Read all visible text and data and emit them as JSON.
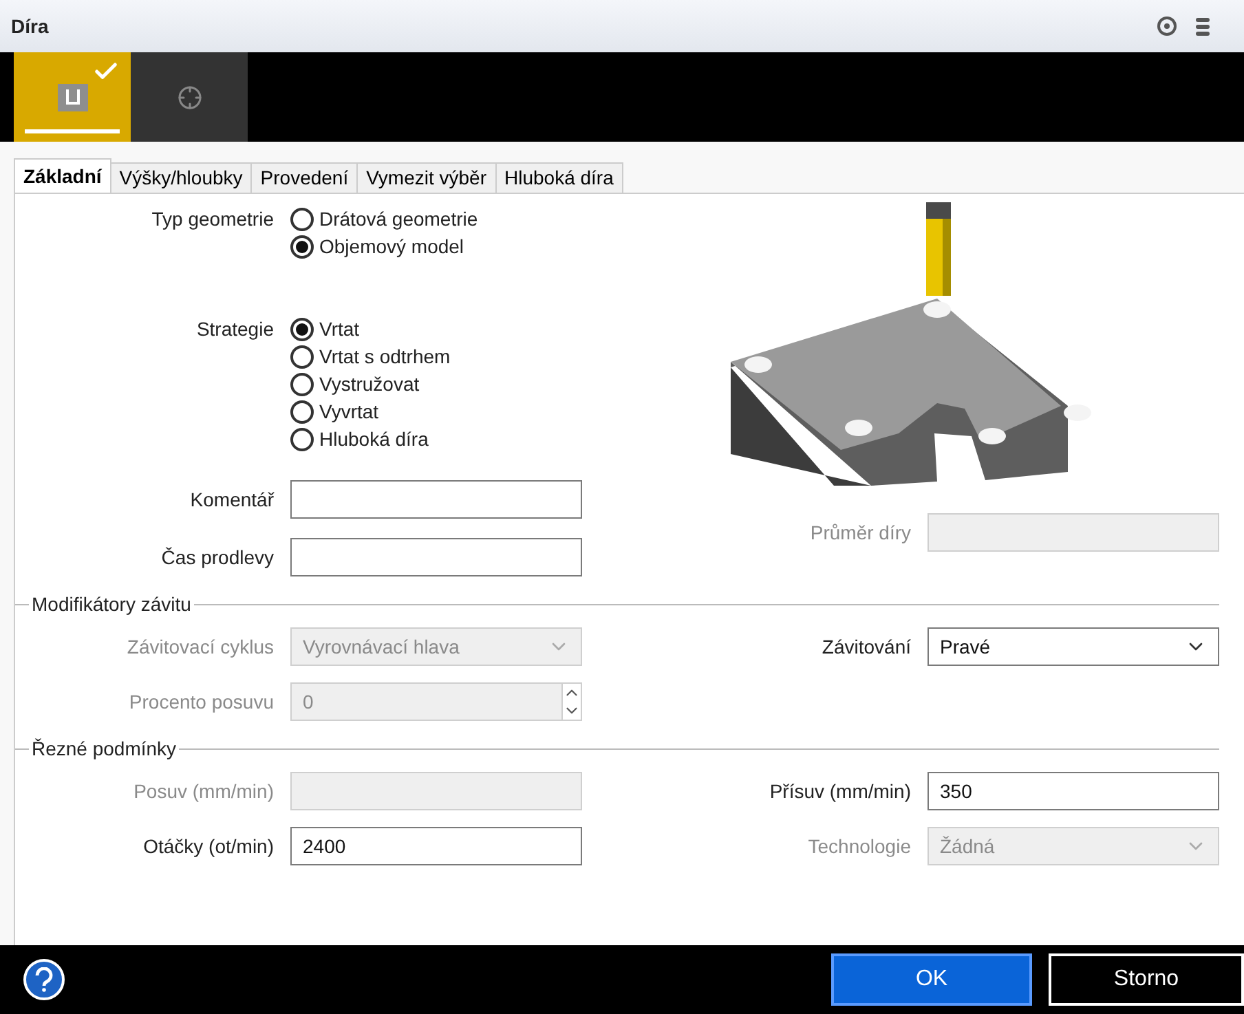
{
  "window": {
    "title": "Díra"
  },
  "modes": [
    {
      "selected": true,
      "done": true
    },
    {
      "selected": false,
      "done": false
    }
  ],
  "tabs": [
    {
      "label": "Základní",
      "selected": true
    },
    {
      "label": "Výšky/hloubky",
      "selected": false
    },
    {
      "label": "Provedení",
      "selected": false
    },
    {
      "label": "Vymezit výběr",
      "selected": false
    },
    {
      "label": "Hluboká díra",
      "selected": false
    }
  ],
  "radio_groups": [
    {
      "label": "Typ geometrie",
      "options": [
        {
          "label": "Drátová geometrie",
          "selected": false
        },
        {
          "label": "Objemový model",
          "selected": true
        }
      ]
    },
    {
      "label": "Strategie",
      "options": [
        {
          "label": "Vrtat",
          "selected": true
        },
        {
          "label": "Vrtat s odtrhem",
          "selected": false
        },
        {
          "label": "Vystružovat",
          "selected": false
        },
        {
          "label": "Vyvrtat",
          "selected": false
        },
        {
          "label": "Hluboká díra",
          "selected": false
        }
      ]
    }
  ],
  "left_fields": [
    {
      "label": "Komentář",
      "kind": "text",
      "disabled": false
    },
    {
      "label": "Čas prodlevy",
      "kind": "text",
      "disabled": false
    }
  ],
  "diameter_field": {
    "label": "Průměr díry",
    "kind": "text",
    "disabled": true
  },
  "sections": [
    {
      "title": "Modifikátory závitu",
      "rows": [
        [
          {
            "label": "Závitovací cyklus",
            "kind": "select",
            "disabled": true,
            "value": "Vyrovnávací hlava"
          },
          {
            "label": "Závitování",
            "kind": "select",
            "disabled": false,
            "value": "Pravé"
          }
        ],
        [
          {
            "label": "Procento posuvu",
            "kind": "spinner",
            "disabled": true,
            "value": "0"
          }
        ]
      ]
    },
    {
      "title": "Řezné podmínky",
      "rows": [
        [
          {
            "label": "Posuv (mm/min)",
            "kind": "text",
            "disabled": true
          },
          {
            "label": "Přísuv (mm/min)",
            "kind": "text",
            "disabled": false,
            "value": "350"
          }
        ],
        [
          {
            "label": "Otáčky (ot/min)",
            "kind": "text",
            "disabled": false,
            "value": "2400"
          },
          {
            "label": "Technologie",
            "kind": "select",
            "disabled": true,
            "value": "Žádná"
          }
        ]
      ]
    }
  ],
  "buttons": [
    {
      "label": "OK",
      "kind": "primary"
    },
    {
      "label": "Storno",
      "kind": "secondary"
    }
  ]
}
